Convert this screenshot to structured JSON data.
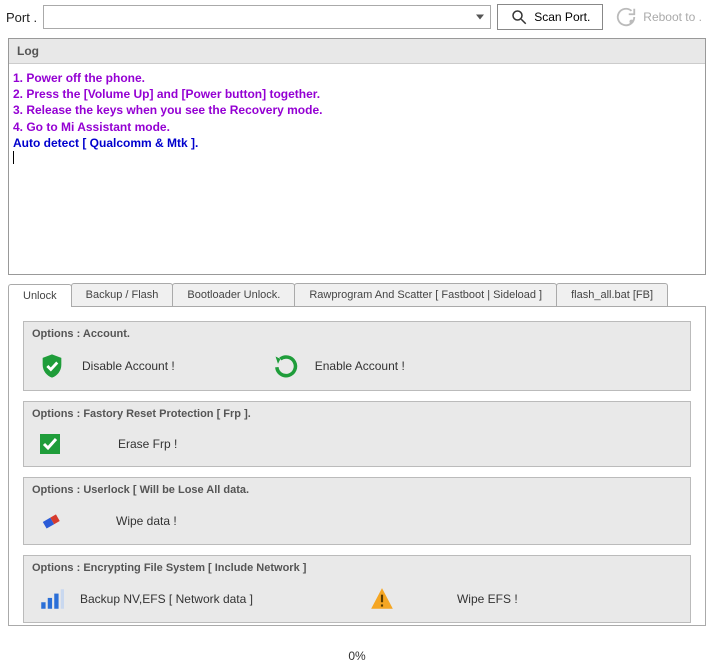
{
  "toolbar": {
    "port_label": "Port .",
    "scan_label": "Scan Port.",
    "reboot_label": "Reboot to ."
  },
  "log": {
    "header": "Log",
    "lines": [
      {
        "cls": "purple",
        "text": "1. Power off the phone."
      },
      {
        "cls": "purple",
        "text": "2. Press the [Volume Up] and [Power button] together."
      },
      {
        "cls": "purple",
        "text": "3. Release the keys when you see the Recovery mode."
      },
      {
        "cls": "purple",
        "text": "4. Go to Mi Assistant mode."
      },
      {
        "cls": "blue",
        "text": "Auto detect  [ Qualcomm & Mtk ]."
      }
    ]
  },
  "tabs": [
    {
      "label": "Unlock",
      "active": true
    },
    {
      "label": "Backup / Flash"
    },
    {
      "label": "Bootloader Unlock."
    },
    {
      "label": "Rawprogram And  Scatter [ Fastboot | Sideload ]"
    },
    {
      "label": "flash_all.bat [FB]"
    }
  ],
  "groups": {
    "account": {
      "title": "Options : Account.",
      "disable_label": "Disable Account  !",
      "enable_label": "Enable Account  !"
    },
    "frp": {
      "title": "Options : Fastory Reset Protection [ Frp ].",
      "erase_label": "Erase Frp  !"
    },
    "userlock": {
      "title": "Options : Userlock  [ Will be  Lose All data.",
      "wipe_label": "Wipe data !"
    },
    "efs": {
      "title": "Options : Encrypting File System [ Include Network ]",
      "backup_label": "Backup  NV,EFS [ Network data ]",
      "wipe_label": "Wipe EFS !"
    }
  },
  "status": {
    "progress": "0%"
  }
}
